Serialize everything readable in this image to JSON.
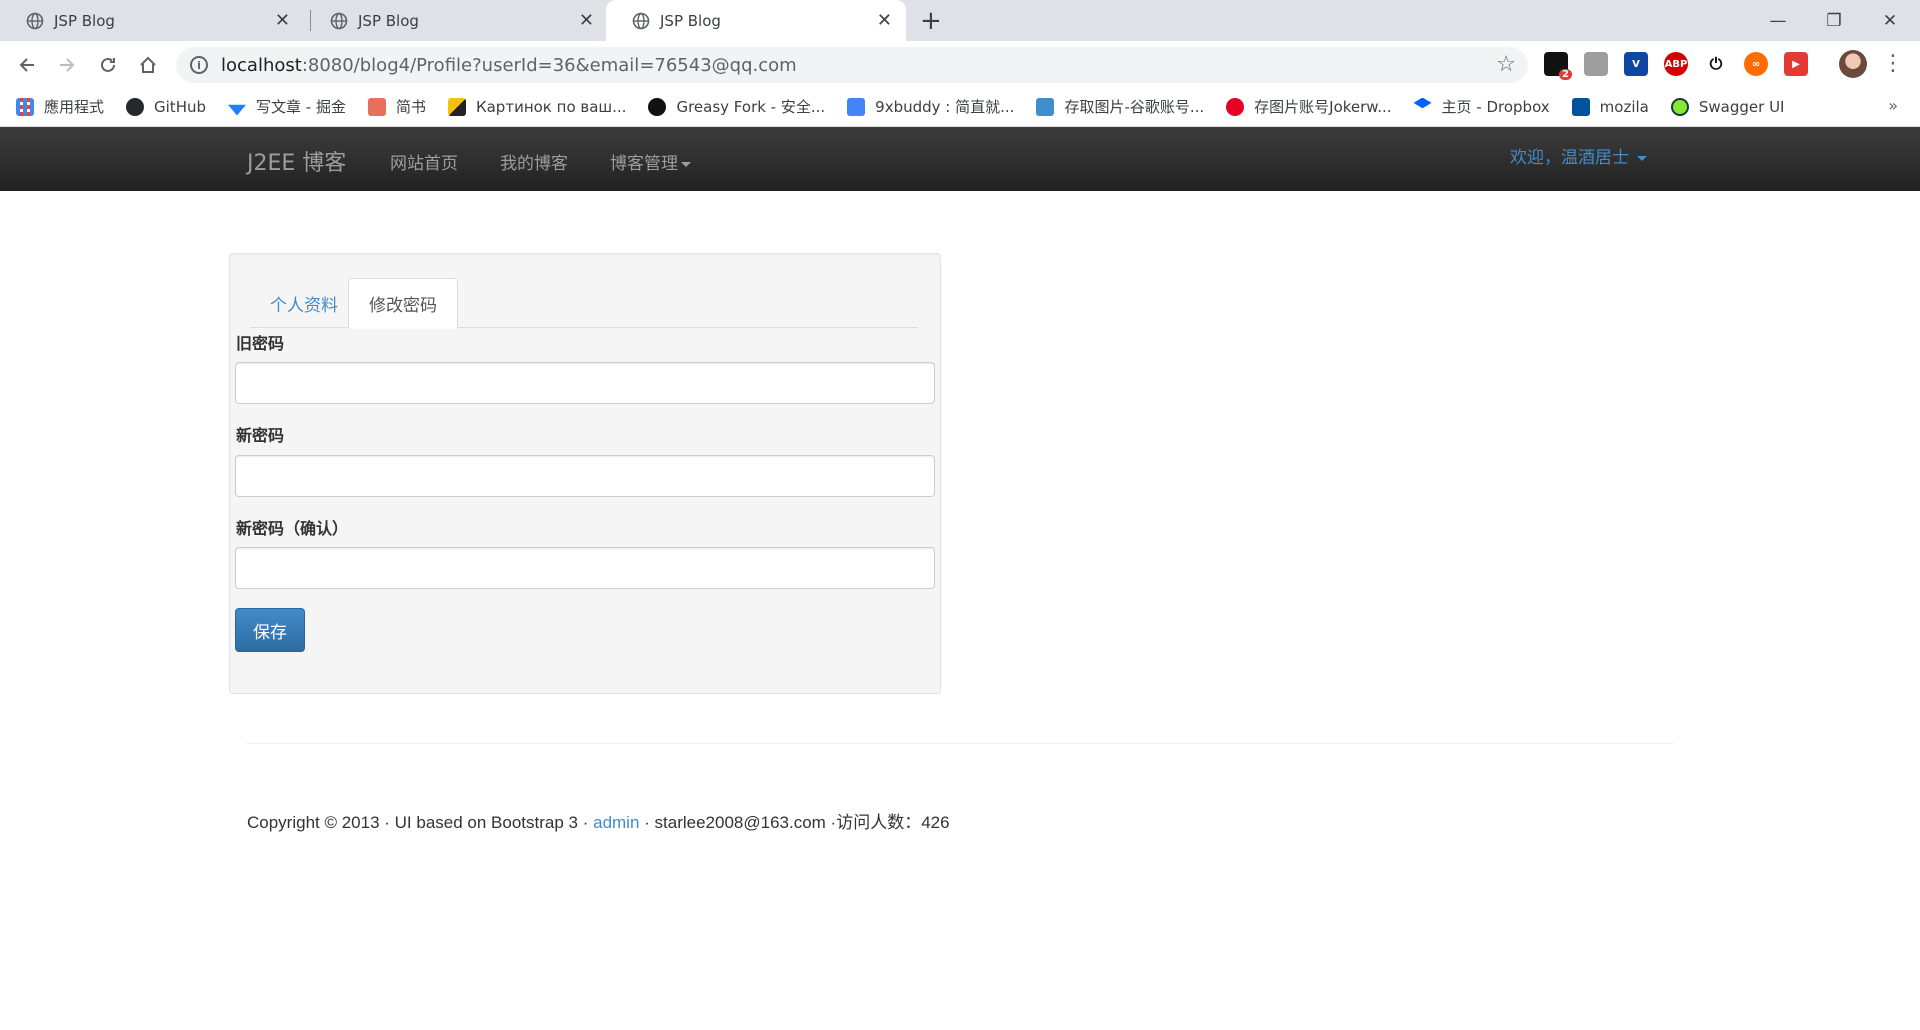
{
  "browser": {
    "tabs": [
      {
        "title": "JSP Blog",
        "active": false
      },
      {
        "title": "JSP Blog",
        "active": false
      },
      {
        "title": "JSP Blog",
        "active": true
      }
    ],
    "close_glyph": "✕",
    "new_tab_glyph": "+",
    "window_controls": {
      "minimize": "—",
      "maximize": "❐",
      "close": "✕"
    },
    "url": {
      "host": "localhost",
      "rest": ":8080/blog4/Profile?userId=36&email=76543@qq.com"
    },
    "ext_badge": "2",
    "bookmarks": [
      {
        "label": "應用程式",
        "icon": "apps-grid-icon",
        "color": "#4285f4"
      },
      {
        "label": "GitHub",
        "icon": "github-icon",
        "color": "#24292e"
      },
      {
        "label": "写文章 - 掘金",
        "icon": "juejin-icon",
        "color": "#1e80ff"
      },
      {
        "label": "简书",
        "icon": "jianshu-icon",
        "color": "#ea6f5a"
      },
      {
        "label": "Картинок по ваш...",
        "icon": "image-icon",
        "color": "#f4c20d"
      },
      {
        "label": "Greasy Fork - 安全...",
        "icon": "greasyfork-icon",
        "color": "#111111"
      },
      {
        "label": "9xbuddy : 简直就...",
        "icon": "doc-icon",
        "color": "#4285f4"
      },
      {
        "label": "存取图片-谷歌账号...",
        "icon": "ibb-icon",
        "color": "#3d8fd1"
      },
      {
        "label": "存图片账号Jokerw...",
        "icon": "pinterest-icon",
        "color": "#e60023"
      },
      {
        "label": "主页 - Dropbox",
        "icon": "dropbox-icon",
        "color": "#0061ff"
      },
      {
        "label": "mozila",
        "icon": "mozilla-icon",
        "color": "#00539f"
      },
      {
        "label": "Swagger UI",
        "icon": "swagger-icon",
        "color": "#85ea2d"
      }
    ],
    "bookmarks_more": "»"
  },
  "site": {
    "brand": "J2EE 博客",
    "nav": [
      "网站首页",
      "我的博客",
      "博客管理"
    ],
    "welcome": "欢迎，温酒居士"
  },
  "profile": {
    "tabs": [
      "个人资料",
      "修改密码"
    ],
    "fields": [
      {
        "label": "旧密码",
        "value": ""
      },
      {
        "label": "新密码",
        "value": ""
      },
      {
        "label": "新密码（确认）",
        "value": ""
      }
    ],
    "save_label": "保存"
  },
  "footer": {
    "prefix": "Copyright © 2013 · UI based on Bootstrap 3 · ",
    "link": "admin",
    "suffix": " · starlee2008@163.com ·访问人数：426"
  },
  "colors": {
    "link": "#428bca",
    "navbar": "#222222",
    "primary_button": "#428bca"
  }
}
